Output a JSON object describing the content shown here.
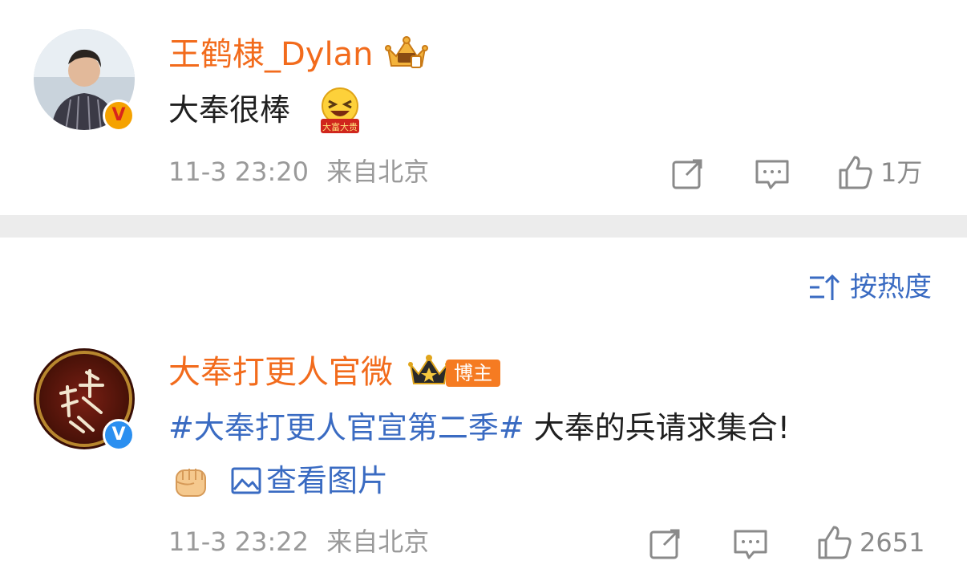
{
  "post1": {
    "username": "王鹤棣_Dylan",
    "avatar_icon": "user-avatar",
    "badge_icon": "verified-v-gold-icon",
    "badge_glyph": "V",
    "crown_icon": "gold-crown-icon",
    "text": "大奉很棒",
    "emoji_icon": "laughing-face-emoji",
    "emoji_caption": "大富大贵",
    "timestamp": "11-3 23:20",
    "source": "来自北京",
    "like_count": "1万"
  },
  "sort": {
    "label": "按热度",
    "icon": "sort-up-icon"
  },
  "post2": {
    "username": "大奉打更人官微",
    "avatar_icon": "drama-logo-avatar",
    "badge_icon": "verified-v-blue-icon",
    "badge_glyph": "V",
    "crown_icon": "black-crown-icon",
    "tag": "博主",
    "hashtag": "#大奉打更人官宣第二季#",
    "text": " 大奉的兵请求集合!",
    "emoji_icon": "raised-fist-emoji",
    "view_picture_label": "查看图片",
    "timestamp": "11-3 23:22",
    "source": "来自北京",
    "like_count": "2651"
  },
  "colors": {
    "username": "#f26b1c",
    "link": "#3a6bc2",
    "meta": "#9a9a9a",
    "divider": "#ececec"
  }
}
